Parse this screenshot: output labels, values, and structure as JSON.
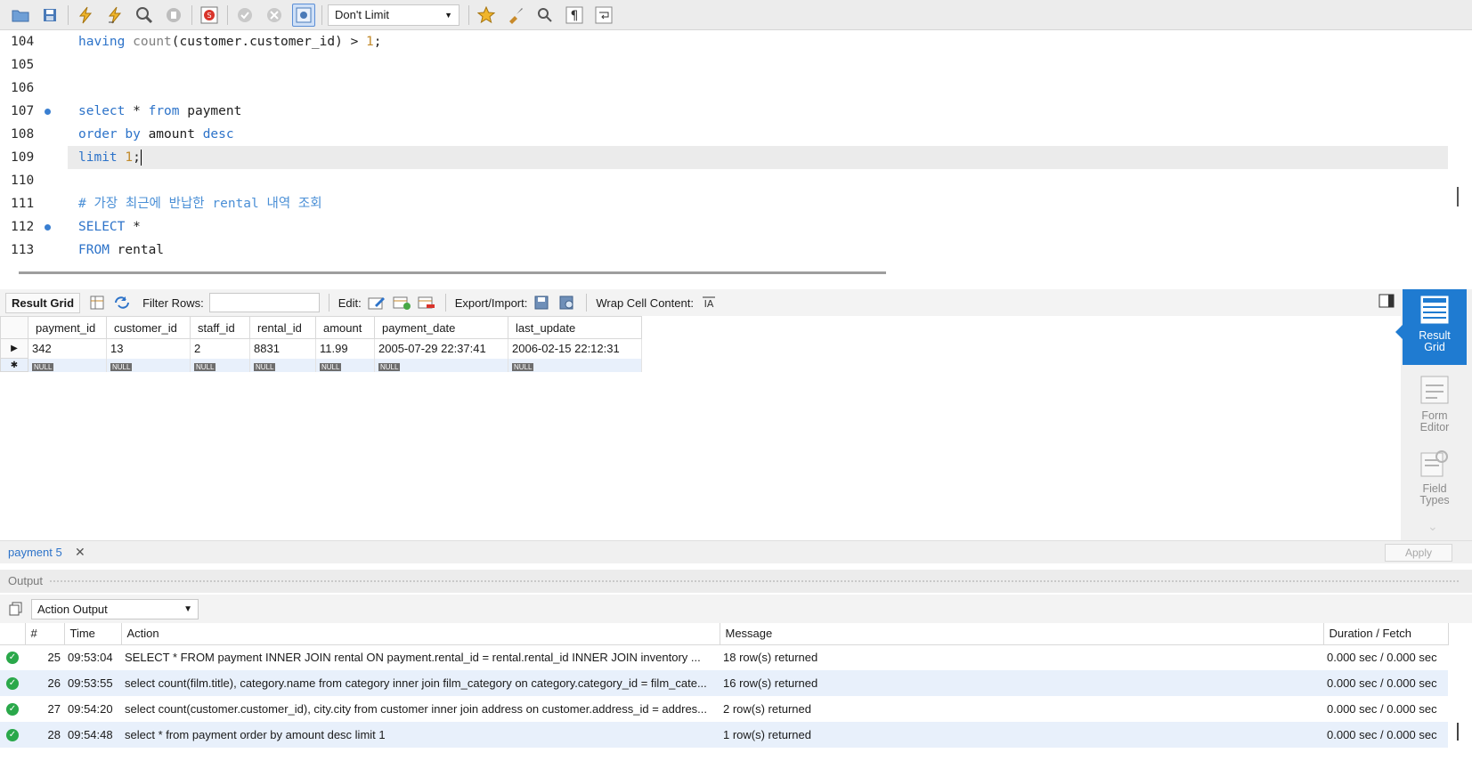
{
  "toolbar": {
    "limit_select": "Don't Limit"
  },
  "editor": {
    "lines": [
      {
        "num": "104"
      },
      {
        "num": "105"
      },
      {
        "num": "106"
      },
      {
        "num": "107"
      },
      {
        "num": "108"
      },
      {
        "num": "109"
      },
      {
        "num": "110"
      },
      {
        "num": "111"
      },
      {
        "num": "112"
      },
      {
        "num": "113"
      }
    ],
    "code": {
      "l104_kw": "having",
      "l104_fn": "count",
      "l104_rest": "(customer.customer_id) > ",
      "l104_num": "1",
      "l104_end": ";",
      "l107_kw1": "select",
      "l107_mid": " * ",
      "l107_kw2": "from",
      "l107_rest": " payment",
      "l108_kw1": "order by",
      "l108_mid": " amount ",
      "l108_kw2": "desc",
      "l109_kw": "limit",
      "l109_num": " 1",
      "l109_end": ";",
      "l111_comment": "# 가장 최근에 반납한 rental 내역 조회",
      "l112_kw": "SELECT",
      "l112_rest": " *",
      "l113_kw": "FROM",
      "l113_rest": " rental"
    }
  },
  "result_toolbar": {
    "title": "Result Grid",
    "filter_label": "Filter Rows:",
    "filter_value": "",
    "edit_label": "Edit:",
    "export_label": "Export/Import:",
    "wrap_label": "Wrap Cell Content:"
  },
  "grid": {
    "columns": [
      "payment_id",
      "customer_id",
      "staff_id",
      "rental_id",
      "amount",
      "payment_date",
      "last_update"
    ],
    "rows": [
      [
        "342",
        "13",
        "2",
        "8831",
        "11.99",
        "2005-07-29 22:37:41",
        "2006-02-15 22:12:31"
      ]
    ],
    "null_label": "NULL"
  },
  "side_panel": {
    "result_grid": "Result Grid",
    "form_editor": "Form Editor",
    "field_types": "Field Types"
  },
  "result_tabs": {
    "tab_label": "payment 5",
    "apply_label": "Apply"
  },
  "output": {
    "header": "Output",
    "selector": "Action Output",
    "columns": [
      "#",
      "Time",
      "Action",
      "Message",
      "Duration / Fetch"
    ],
    "rows": [
      {
        "num": "25",
        "time": "09:53:04",
        "action": "SELECT * FROM payment INNER JOIN rental ON payment.rental_id = rental.rental_id INNER JOIN inventory ...",
        "message": "18 row(s) returned",
        "duration": "0.000 sec / 0.000 sec"
      },
      {
        "num": "26",
        "time": "09:53:55",
        "action": "select count(film.title), category.name from category inner join film_category on category.category_id = film_cate...",
        "message": "16 row(s) returned",
        "duration": "0.000 sec / 0.000 sec"
      },
      {
        "num": "27",
        "time": "09:54:20",
        "action": "select count(customer.customer_id), city.city from customer inner join address on customer.address_id = addres...",
        "message": "2 row(s) returned",
        "duration": "0.000 sec / 0.000 sec"
      },
      {
        "num": "28",
        "time": "09:54:48",
        "action": "select * from payment order by amount desc limit 1",
        "message": "1 row(s) returned",
        "duration": "0.000 sec / 0.000 sec"
      }
    ]
  },
  "colors": {
    "keyword": "#2d73c9",
    "accent": "#1f7bd1",
    "ok": "#2aa84a"
  }
}
